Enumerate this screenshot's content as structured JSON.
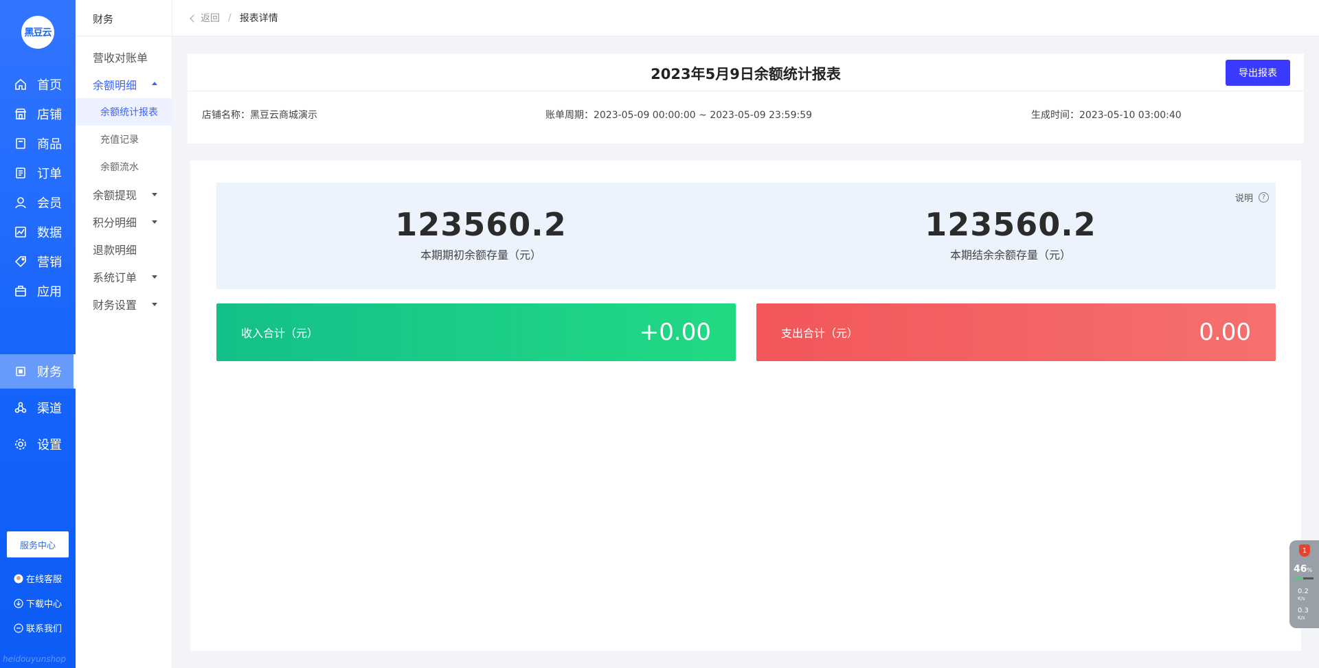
{
  "nav": {
    "logo_text": "黑豆云",
    "items": [
      {
        "label": "首页",
        "icon": "home-icon"
      },
      {
        "label": "店铺",
        "icon": "shop-icon"
      },
      {
        "label": "商品",
        "icon": "goods-icon"
      },
      {
        "label": "订单",
        "icon": "order-icon"
      },
      {
        "label": "会员",
        "icon": "member-icon"
      },
      {
        "label": "数据",
        "icon": "chart-icon"
      },
      {
        "label": "营销",
        "icon": "tag-icon"
      },
      {
        "label": "应用",
        "icon": "app-icon"
      },
      {
        "label": "财务",
        "icon": "finance-icon",
        "active": true
      },
      {
        "label": "渠道",
        "icon": "channel-icon"
      },
      {
        "label": "设置",
        "icon": "gear-icon"
      }
    ],
    "service_center": "服务中心",
    "links": [
      "在线客服",
      "下载中心",
      "联系我们"
    ],
    "footer_brand": "heidouyunshop"
  },
  "subnav": {
    "title": "财务",
    "items": [
      {
        "label": "营收对账单"
      },
      {
        "label": "余额明细",
        "open": true,
        "children": [
          "余额统计报表",
          "充值记录",
          "余额流水"
        ]
      },
      {
        "label": "余额提现",
        "caret": true
      },
      {
        "label": "积分明细",
        "caret": true
      },
      {
        "label": "退款明细"
      },
      {
        "label": "系统订单",
        "caret": true
      },
      {
        "label": "财务设置",
        "caret": true
      }
    ]
  },
  "breadcrumb": {
    "back": "返回",
    "separator": "/",
    "current": "报表详情"
  },
  "report": {
    "title": "2023年5月9日余额统计报表",
    "export_label": "导出报表",
    "store_name": "店铺名称：黑豆云商城演示",
    "period": "账单周期：2023-05-09 00:00:00 ~ 2023-05-09 23:59:59",
    "generated": "生成时间：2023-05-10 03:00:40"
  },
  "summary": {
    "note_label": "说明",
    "note_icon": "?",
    "opening_value": "123560.2",
    "opening_label": "本期期初余额存量（元）",
    "closing_value": "123560.2",
    "closing_label": "本期结余余额存量（元）"
  },
  "stats": {
    "income_label": "收入合计（元）",
    "income_value": "+0.00",
    "expense_label": "支出合计（元）",
    "expense_value": "0.00",
    "income_color": "#13c089",
    "expense_color": "#f25659"
  },
  "monitor": {
    "badge": "1",
    "percent": "46",
    "percent_unit": "%",
    "up_speed": "0.2",
    "down_speed": "0.3",
    "speed_unit": "K/s"
  }
}
